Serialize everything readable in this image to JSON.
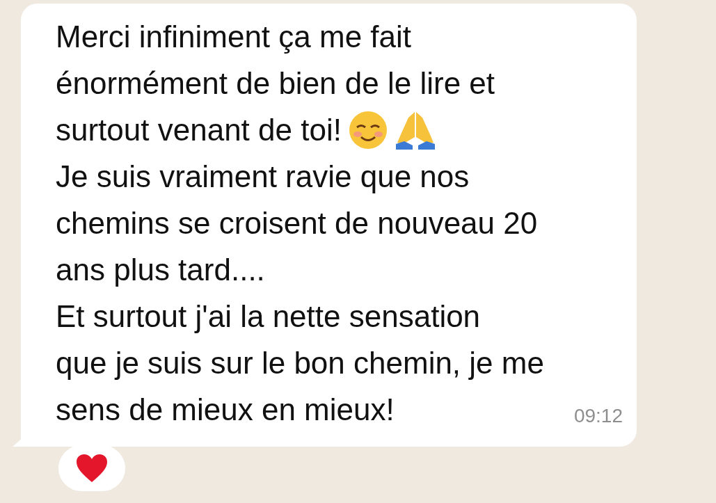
{
  "message": {
    "lines": [
      {
        "text": "Merci infiniment ça me fait"
      },
      {
        "text": "énormément de bien de le lire et"
      },
      {
        "text": "surtout venant de toi!",
        "emojis": [
          {
            "kind": "smiling-face"
          },
          {
            "kind": "praying-hands"
          }
        ]
      },
      {
        "text": "Je suis vraiment ravie que nos"
      },
      {
        "text": "chemins se croisent de nouveau 20"
      },
      {
        "text": "ans plus tard...."
      },
      {
        "text": "Et surtout j'ai la nette sensation"
      },
      {
        "text": "que je suis sur le bon chemin, je me"
      },
      {
        "text": "sens de mieux en mieux!"
      }
    ],
    "time": "09:12",
    "reaction": {
      "kind": "heart"
    }
  }
}
